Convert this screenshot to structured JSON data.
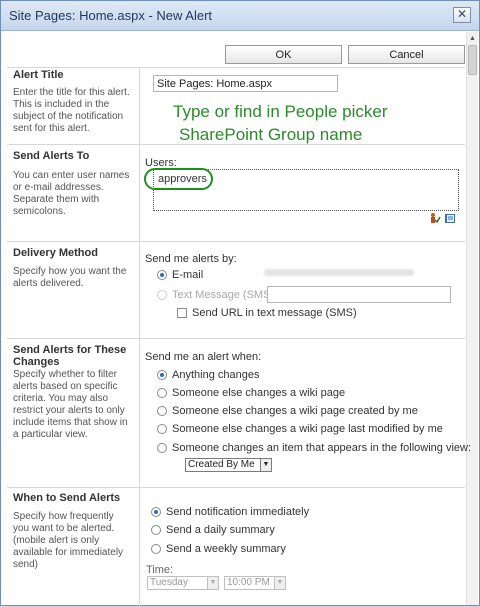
{
  "window": {
    "title": "Site Pages: Home.aspx - New Alert",
    "close_glyph": "✕"
  },
  "toolbar": {
    "ok_label": "OK",
    "cancel_label": "Cancel"
  },
  "alert_title": {
    "heading": "Alert Title",
    "description": "Enter the title for this alert. This is included in the subject of the notification sent for this alert.",
    "value": "Site Pages: Home.aspx"
  },
  "annotation": {
    "line1": "Type or find in People picker",
    "line2": "SharePoint Group name"
  },
  "send_to": {
    "heading": "Send Alerts To",
    "description": "You can enter user names or e-mail addresses. Separate them with semicolons.",
    "users_label": "Users:",
    "users_value": "approvers",
    "icons": [
      "check-names-icon",
      "browse-address-book-icon"
    ]
  },
  "delivery": {
    "heading": "Delivery Method",
    "description": "Specify how you want the alerts delivered.",
    "prompt": "Send me alerts by:",
    "email_label": "E-mail",
    "sms_label": "Text Message (SMS)",
    "send_url_label": "Send URL in text message (SMS)",
    "selected": "E-mail"
  },
  "changes": {
    "heading": "Send Alerts for These Changes",
    "description": "Specify whether to filter alerts based on specific criteria. You may also restrict your alerts to only include items that show in a particular view.",
    "prompt": "Send me an alert when:",
    "options": [
      "Anything changes",
      "Someone else changes a wiki page",
      "Someone else changes a wiki page created by me",
      "Someone else changes a wiki page last modified by me",
      "Someone changes an item that appears in the following view:"
    ],
    "selected_index": 0,
    "view_value": "Created By Me"
  },
  "when": {
    "heading": "When to Send Alerts",
    "description": "Specify how frequently you want to be alerted. (mobile alert is only available for immediately send)",
    "options": [
      "Send notification immediately",
      "Send a daily summary",
      "Send a weekly summary"
    ],
    "selected_index": 0,
    "time_label": "Time:",
    "day_value": "Tuesday",
    "time_value": "10:00 PM"
  },
  "colors": {
    "annotation": "#2b8a2b",
    "highlight": "#1d8f1d",
    "radio_selected": "#2a6acb"
  }
}
